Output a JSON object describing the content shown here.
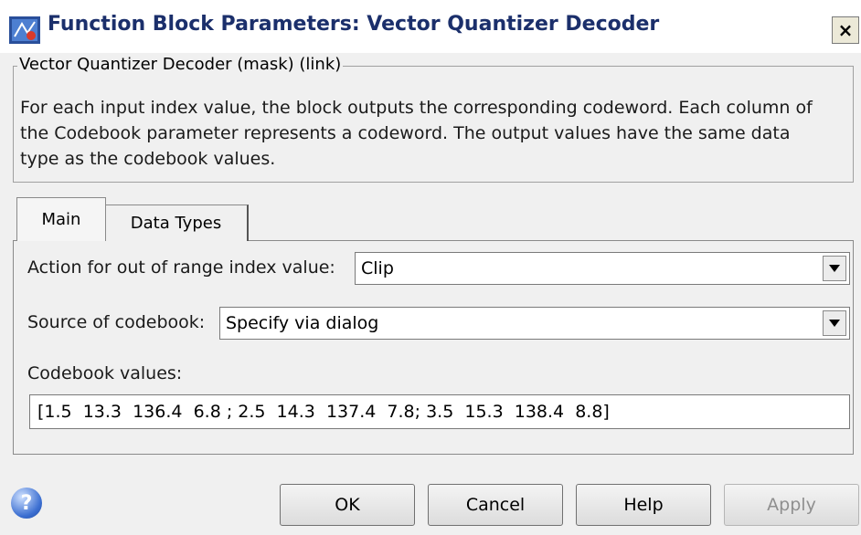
{
  "window": {
    "title": "Function Block Parameters: Vector Quantizer Decoder",
    "close_glyph": "×"
  },
  "description": {
    "group_label": "Vector Quantizer Decoder (mask) (link)",
    "lines": [
      "For each input index value, the block outputs the corresponding codeword. Each column of",
      "the Codebook parameter represents a codeword. The output values have the same data",
      "type as the codebook values."
    ]
  },
  "tabs": [
    {
      "label": "Main",
      "selected": true
    },
    {
      "label": "Data Types",
      "selected": false
    }
  ],
  "main": {
    "action_label": "Action for out of range index value:",
    "action_value": "Clip",
    "source_label": "Source of codebook:",
    "source_value": "Specify via dialog",
    "codebook_label": "Codebook values:",
    "codebook_value": "[1.5  13.3  136.4  6.8 ; 2.5  14.3  137.4  7.8; 3.5  15.3  138.4  8.8]"
  },
  "buttons": {
    "ok": "OK",
    "cancel": "Cancel",
    "help": "Help",
    "apply": "Apply",
    "help_icon_glyph": "?"
  }
}
